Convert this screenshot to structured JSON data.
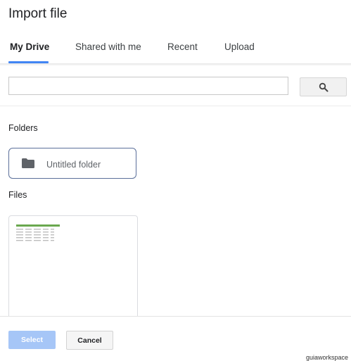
{
  "dialog": {
    "title": "Import file"
  },
  "tabs": [
    {
      "label": "My Drive",
      "active": true
    },
    {
      "label": "Shared with me",
      "active": false
    },
    {
      "label": "Recent",
      "active": false
    },
    {
      "label": "Upload",
      "active": false
    }
  ],
  "search": {
    "value": "",
    "button_icon": "search-icon"
  },
  "folders": {
    "heading": "Folders",
    "items": [
      {
        "name": "Untitled folder",
        "icon": "folder-icon"
      }
    ]
  },
  "files": {
    "heading": "Files",
    "items": [
      {
        "thumbnail": "spreadsheet-thumbnail"
      }
    ]
  },
  "footer": {
    "select_label": "Select",
    "cancel_label": "Cancel"
  },
  "watermark": "guiaworkspace",
  "colors": {
    "accent": "#4285f4",
    "select_button_disabled": "#a6c6f7",
    "folder_border": "#5b6f9a",
    "thumb_header": "#6aa84f"
  }
}
